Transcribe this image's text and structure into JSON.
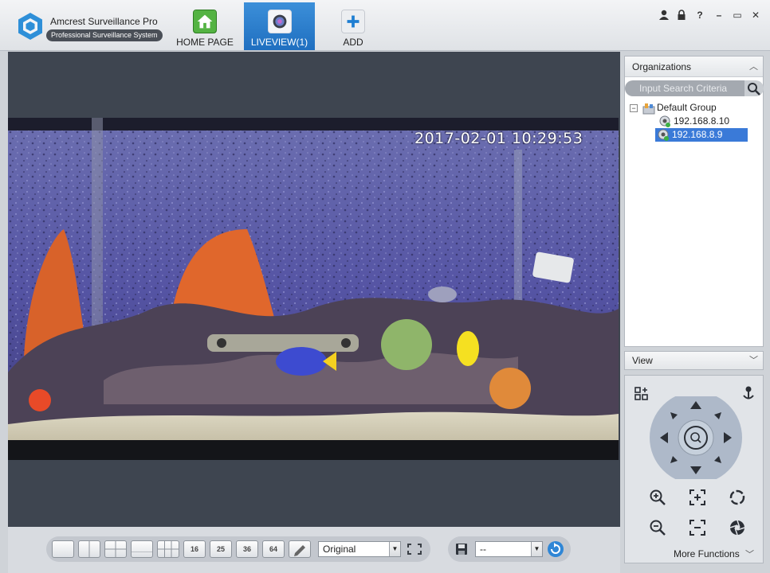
{
  "app": {
    "name": "Amcrest Surveillance Pro",
    "subtitle": "Professional Surveillance System"
  },
  "nav_tabs": [
    {
      "label": "HOME PAGE",
      "icon": "home-icon"
    },
    {
      "label": "LIVEVIEW(1)",
      "icon": "camera-icon",
      "active": true
    },
    {
      "label": "ADD",
      "icon": "plus-icon"
    }
  ],
  "window_controls": [
    "user-icon",
    "lock-icon",
    "help-icon",
    "minimize-icon",
    "maximize-icon",
    "close-icon"
  ],
  "window_glyphs": {
    "help": "?",
    "minimize": "–",
    "maximize": "▭",
    "close": "✕"
  },
  "video": {
    "timestamp": "2017-02-01 10:29:53"
  },
  "toolbar": {
    "layout_buttons": [
      "",
      "",
      "",
      "",
      "",
      "16",
      "25",
      "36",
      "64",
      ""
    ],
    "scale_select": "Original",
    "stream_select": "--",
    "arrow": "▼"
  },
  "organizations": {
    "title": "Organizations",
    "search_placeholder": "Input Search Criteria",
    "group": "Default Group",
    "expander": "−",
    "devices": [
      "192.168.8.10",
      "192.168.8.9"
    ],
    "selected_device": "192.168.8.9"
  },
  "view_panel": {
    "title": "View"
  },
  "ptz": {
    "more_functions": "More Functions"
  },
  "colors": {
    "active_tab": "#2a7ccb",
    "selection": "#3a7ad8",
    "panel_bg": "#3e4550"
  }
}
